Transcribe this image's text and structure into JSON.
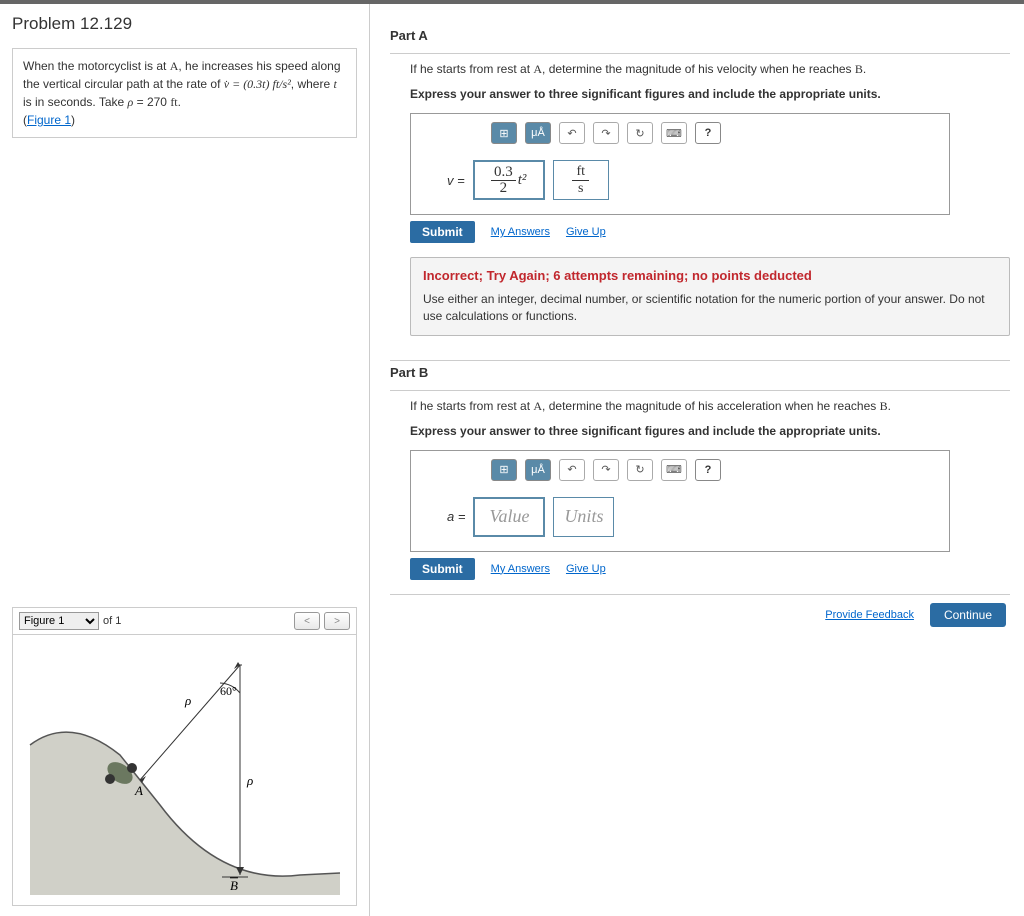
{
  "problem": {
    "title": "Problem 12.129",
    "text_1": "When the motorcyclist is at ",
    "point_A": "A",
    "text_2": ", he increases his speed along the vertical circular path at the rate of ",
    "vdot": "v̇ = (0.3t) ft/s²",
    "text_3": ", where ",
    "t_var": "t",
    "text_4": " is in seconds. Take ",
    "rho": "ρ",
    "eq": " = 270 ",
    "ft": "ft",
    "period": ".",
    "figure_link": "Figure 1"
  },
  "figure": {
    "selected": "Figure 1",
    "of_label": "of 1",
    "angle": "60°",
    "rho1": "ρ",
    "rho2": "ρ",
    "pointA": "A",
    "pointB": "B"
  },
  "partA": {
    "title": "Part A",
    "prompt_1": "If he starts from rest at ",
    "prompt_A": "A",
    "prompt_2": ", determine the magnitude of his velocity when he reaches ",
    "prompt_B": "B",
    "prompt_3": ".",
    "instruction": "Express your answer to three significant figures and include the appropriate units.",
    "var": "v =",
    "value_num": "0.3",
    "value_den": "2",
    "value_suffix": "t²",
    "unit_top": "ft",
    "unit_bot": "s",
    "submit": "Submit",
    "my_answers": "My Answers",
    "give_up": "Give Up",
    "feedback_title": "Incorrect; Try Again; 6 attempts remaining; no points deducted",
    "feedback_text": "Use either an integer, decimal number, or scientific notation for the numeric portion of your answer. Do not use calculations or functions."
  },
  "partB": {
    "title": "Part B",
    "prompt_1": "If he starts from rest at ",
    "prompt_A": "A",
    "prompt_2": ", determine the magnitude of his acceleration when he reaches ",
    "prompt_B": "B",
    "prompt_3": ".",
    "instruction": "Express your answer to three significant figures and include the appropriate units.",
    "var": "a =",
    "value_placeholder": "Value",
    "units_placeholder": "Units",
    "submit": "Submit",
    "my_answers": "My Answers",
    "give_up": "Give Up"
  },
  "footer": {
    "provide_feedback": "Provide Feedback",
    "continue": "Continue"
  },
  "toolbar": {
    "templates": "⊞",
    "units": "μÅ",
    "undo": "↶",
    "redo": "↷",
    "reset": "↻",
    "keyboard": "⌨",
    "help": "?"
  }
}
